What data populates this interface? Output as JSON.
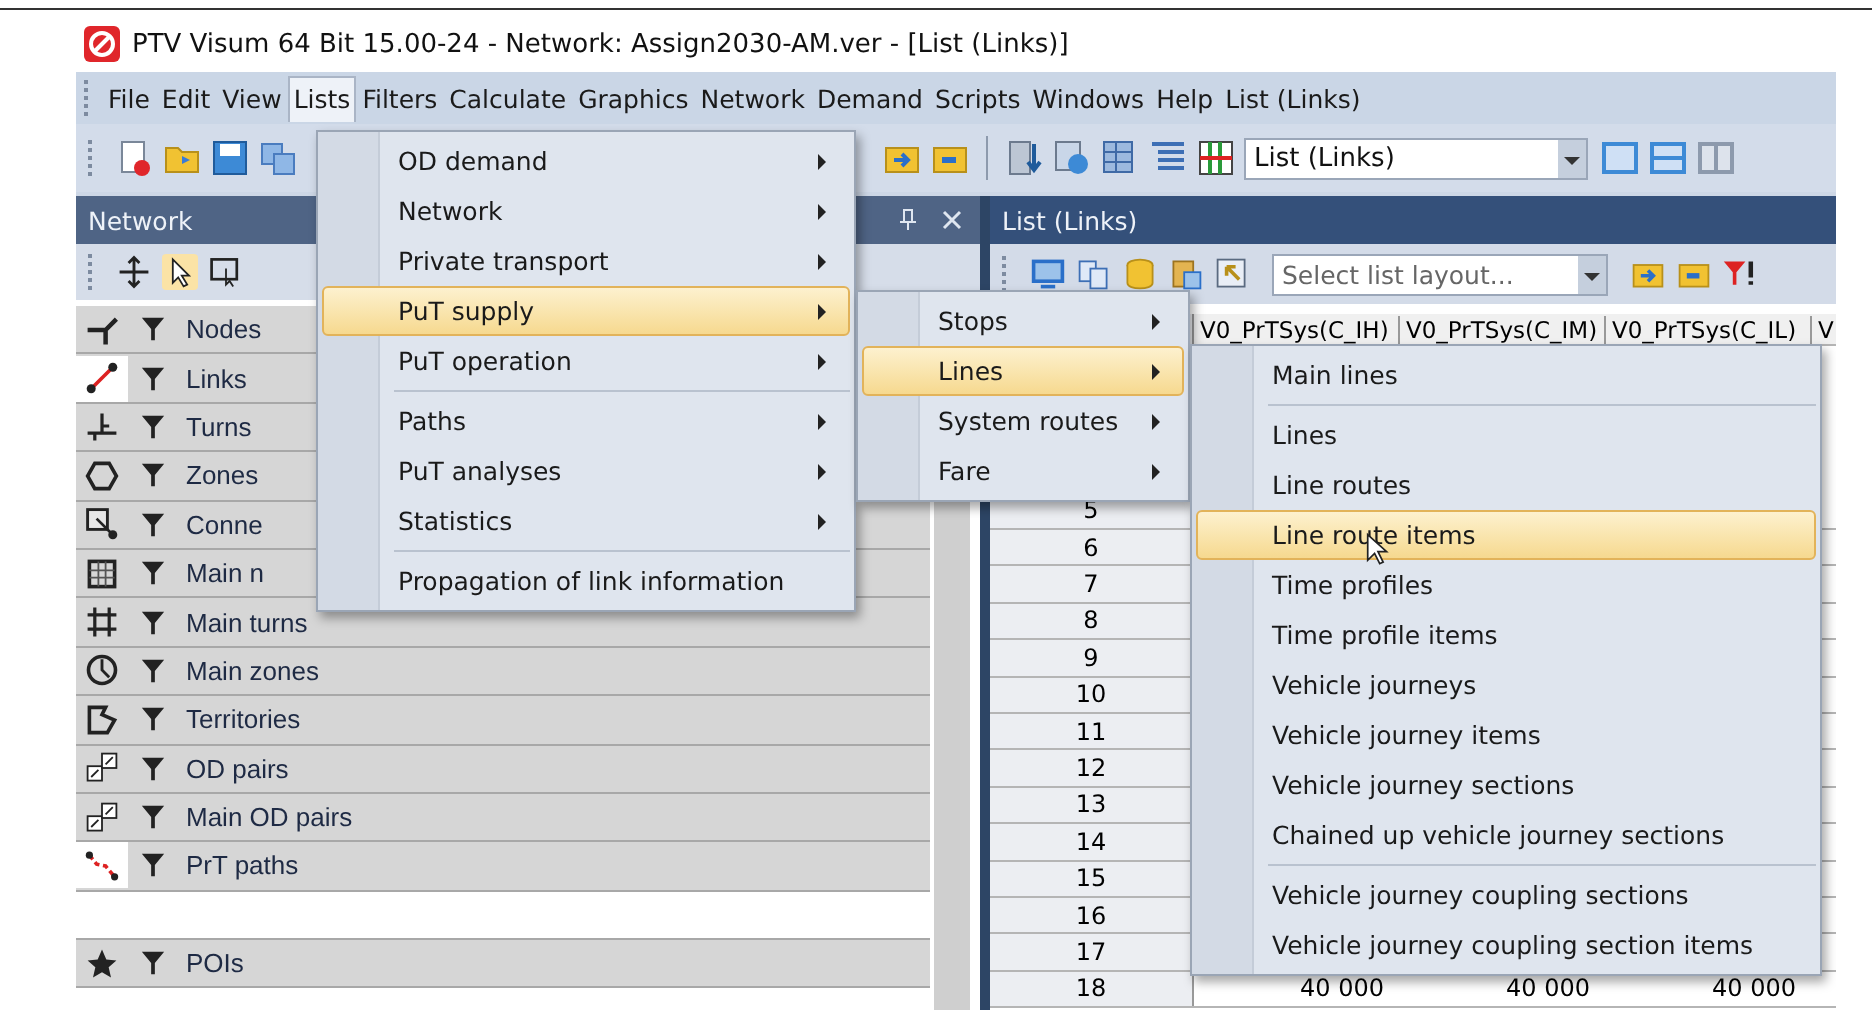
{
  "window": {
    "title": "PTV Visum 64 Bit 15.00-24 - Network: Assign2030-AM.ver - [List (Links)]"
  },
  "menu_bar": [
    {
      "label": "File",
      "selected": false
    },
    {
      "label": "Edit",
      "selected": false
    },
    {
      "label": "View",
      "selected": false
    },
    {
      "label": "Lists",
      "selected": true
    },
    {
      "label": "Filters",
      "selected": false
    },
    {
      "label": "Calculate",
      "selected": false
    },
    {
      "label": "Graphics",
      "selected": false
    },
    {
      "label": "Network",
      "selected": false
    },
    {
      "label": "Demand",
      "selected": false
    },
    {
      "label": "Scripts",
      "selected": false
    },
    {
      "label": "Windows",
      "selected": false
    },
    {
      "label": "Help",
      "selected": false
    },
    {
      "label": "List (Links)",
      "selected": false
    }
  ],
  "toolbar": {
    "list_select": {
      "value": "List (Links)"
    }
  },
  "network_panel": {
    "title": "Network",
    "items": [
      {
        "kind": "entry",
        "label": "Nodes",
        "active": false
      },
      {
        "kind": "entry",
        "label": "Links",
        "active": true
      },
      {
        "kind": "entry",
        "label": "Turns",
        "active": false
      },
      {
        "kind": "entry",
        "label": "Zones",
        "active": false
      },
      {
        "kind": "entry",
        "label": "Conne",
        "active": false
      },
      {
        "kind": "entry",
        "label": "Main n",
        "active": false
      },
      {
        "kind": "entry",
        "label": "Main turns",
        "active": false
      },
      {
        "kind": "entry",
        "label": "Main zones",
        "active": false
      },
      {
        "kind": "entry",
        "label": "Territories",
        "active": false
      },
      {
        "kind": "entry",
        "label": "OD pairs",
        "active": false
      },
      {
        "kind": "entry",
        "label": "Main OD pairs",
        "active": false
      },
      {
        "kind": "entry",
        "label": "PrT paths",
        "active": true
      },
      {
        "kind": "blank"
      },
      {
        "kind": "entry",
        "label": "POIs",
        "active": false
      }
    ]
  },
  "list_panel": {
    "title": "List (Links)",
    "layout_select": {
      "placeholder": "Select list layout..."
    },
    "columns": [
      "V0_PrTSys(C_IH)",
      "V0_PrTSys(C_IM)",
      "V0_PrTSys(C_IL)",
      "V"
    ],
    "rows": [
      {
        "number": "5"
      },
      {
        "number": "6"
      },
      {
        "number": "7"
      },
      {
        "number": "8"
      },
      {
        "number": "9"
      },
      {
        "number": "10"
      },
      {
        "number": "11"
      },
      {
        "number": "12"
      },
      {
        "number": "13"
      },
      {
        "number": "14"
      },
      {
        "number": "15"
      },
      {
        "number": "16"
      },
      {
        "number": "17"
      },
      {
        "number": "18",
        "cells": [
          "40 000",
          "40 000",
          "40 000"
        ]
      }
    ]
  },
  "menus": [
    {
      "items": [
        {
          "kind": "item",
          "label": "OD demand",
          "submenu": true,
          "selected": false
        },
        {
          "kind": "item",
          "label": "Network",
          "submenu": true,
          "selected": false
        },
        {
          "kind": "item",
          "label": "Private transport",
          "submenu": true,
          "selected": false
        },
        {
          "kind": "item",
          "label": "PuT supply",
          "submenu": true,
          "selected": true
        },
        {
          "kind": "item",
          "label": "PuT operation",
          "submenu": true,
          "selected": false
        },
        {
          "kind": "separator"
        },
        {
          "kind": "item",
          "label": "Paths",
          "submenu": true,
          "selected": false
        },
        {
          "kind": "item",
          "label": "PuT analyses",
          "submenu": true,
          "selected": false
        },
        {
          "kind": "item",
          "label": "Statistics",
          "submenu": true,
          "selected": false
        },
        {
          "kind": "separator"
        },
        {
          "kind": "item",
          "label": "Propagation of link information",
          "submenu": false,
          "selected": false
        }
      ]
    },
    {
      "items": [
        {
          "kind": "item",
          "label": "Stops",
          "submenu": true,
          "selected": false
        },
        {
          "kind": "item",
          "label": "Lines",
          "submenu": true,
          "selected": true
        },
        {
          "kind": "item",
          "label": "System routes",
          "submenu": true,
          "selected": false
        },
        {
          "kind": "item",
          "label": "Fare",
          "submenu": true,
          "selected": false
        }
      ]
    },
    {
      "items": [
        {
          "kind": "item",
          "label": "Main lines",
          "submenu": false,
          "selected": false
        },
        {
          "kind": "separator"
        },
        {
          "kind": "item",
          "label": "Lines",
          "submenu": false,
          "selected": false
        },
        {
          "kind": "item",
          "label": "Line routes",
          "submenu": false,
          "selected": false
        },
        {
          "kind": "item",
          "label": "Line route items",
          "submenu": false,
          "selected": true
        },
        {
          "kind": "item",
          "label": "Time profiles",
          "submenu": false,
          "selected": false
        },
        {
          "kind": "item",
          "label": "Time profile items",
          "submenu": false,
          "selected": false
        },
        {
          "kind": "item",
          "label": "Vehicle journeys",
          "submenu": false,
          "selected": false
        },
        {
          "kind": "item",
          "label": "Vehicle journey items",
          "submenu": false,
          "selected": false
        },
        {
          "kind": "item",
          "label": "Vehicle journey sections",
          "submenu": false,
          "selected": false
        },
        {
          "kind": "item",
          "label": "Chained up vehicle journey sections",
          "submenu": false,
          "selected": false
        },
        {
          "kind": "separator"
        },
        {
          "kind": "item",
          "label": "Vehicle journey coupling sections",
          "submenu": false,
          "selected": false
        },
        {
          "kind": "item",
          "label": "Vehicle journey coupling section items",
          "submenu": false,
          "selected": false
        }
      ]
    }
  ]
}
